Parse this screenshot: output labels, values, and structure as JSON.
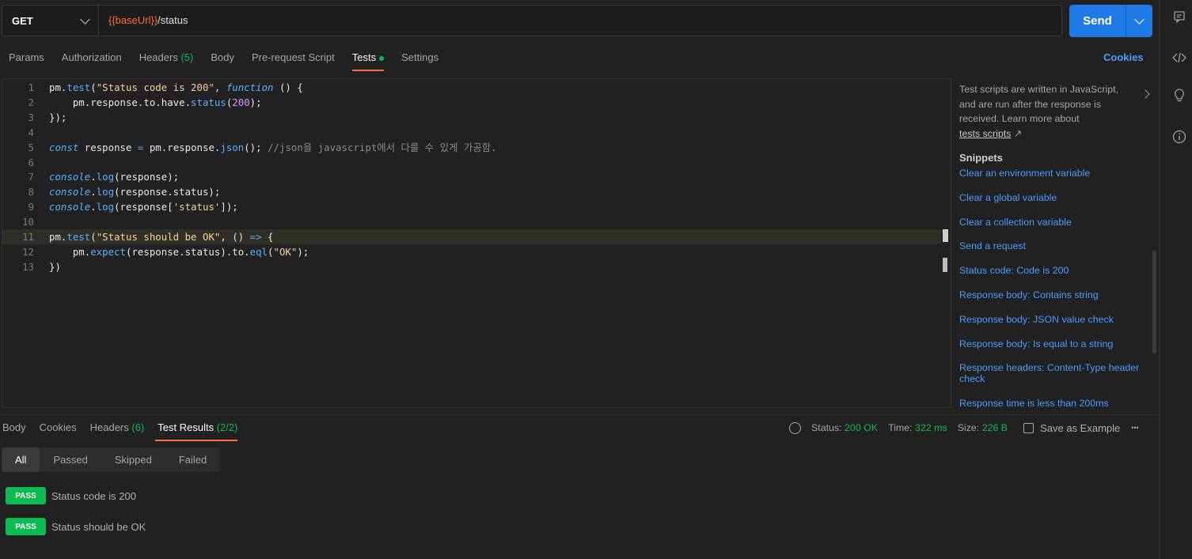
{
  "request": {
    "method": "GET",
    "url_variable": "{{baseUrl}}",
    "url_path": "/status",
    "send_label": "Send"
  },
  "request_tabs": [
    {
      "label": "Params",
      "count": "",
      "active": false
    },
    {
      "label": "Authorization",
      "count": "",
      "active": false
    },
    {
      "label": "Headers",
      "count": "(5)",
      "active": false
    },
    {
      "label": "Body",
      "count": "",
      "active": false
    },
    {
      "label": "Pre-request Script",
      "count": "",
      "active": false
    },
    {
      "label": "Tests",
      "count": "",
      "active": true,
      "dot": true
    },
    {
      "label": "Settings",
      "count": "",
      "active": false
    }
  ],
  "cookies_label": "Cookies",
  "editor": {
    "lines": [
      {
        "n": "1",
        "tokens": [
          [
            "c-def",
            "pm."
          ],
          [
            "c-fn",
            "test"
          ],
          [
            "c-def",
            "("
          ],
          [
            "c-str",
            "\"Status code is 200\""
          ],
          [
            "c-def",
            ", "
          ],
          [
            "c-kw",
            "function"
          ],
          [
            "c-def",
            " () {"
          ]
        ]
      },
      {
        "n": "2",
        "tokens": [
          [
            "c-def",
            "    pm.response.to.have."
          ],
          [
            "c-fn",
            "status"
          ],
          [
            "c-def",
            "("
          ],
          [
            "c-num",
            "200"
          ],
          [
            "c-def",
            ");"
          ]
        ]
      },
      {
        "n": "3",
        "tokens": [
          [
            "c-def",
            "});"
          ]
        ]
      },
      {
        "n": "4",
        "tokens": []
      },
      {
        "n": "5",
        "tokens": [
          [
            "c-kw",
            "const"
          ],
          [
            "c-def",
            " response "
          ],
          [
            "c-op",
            "="
          ],
          [
            "c-def",
            " pm.response."
          ],
          [
            "c-fn",
            "json"
          ],
          [
            "c-def",
            "(); "
          ],
          [
            "c-com",
            "//json을 javascript에서 다룰 수 있게 가공함."
          ]
        ]
      },
      {
        "n": "6",
        "tokens": []
      },
      {
        "n": "7",
        "tokens": [
          [
            "c-kw",
            "console"
          ],
          [
            "c-def",
            "."
          ],
          [
            "c-fn",
            "log"
          ],
          [
            "c-def",
            "(response);"
          ]
        ]
      },
      {
        "n": "8",
        "tokens": [
          [
            "c-kw",
            "console"
          ],
          [
            "c-def",
            "."
          ],
          [
            "c-fn",
            "log"
          ],
          [
            "c-def",
            "(response.status);"
          ]
        ]
      },
      {
        "n": "9",
        "tokens": [
          [
            "c-kw",
            "console"
          ],
          [
            "c-def",
            "."
          ],
          [
            "c-fn",
            "log"
          ],
          [
            "c-def",
            "(response["
          ],
          [
            "c-str",
            "'status'"
          ],
          [
            "c-def",
            "]);"
          ]
        ]
      },
      {
        "n": "10",
        "tokens": []
      },
      {
        "n": "11",
        "tokens": [
          [
            "c-def",
            "pm."
          ],
          [
            "c-fn",
            "test"
          ],
          [
            "c-def",
            "("
          ],
          [
            "c-str",
            "\"Status should be OK\""
          ],
          [
            "c-def",
            ", () "
          ],
          [
            "c-op",
            "=>"
          ],
          [
            "c-def",
            " {"
          ]
        ],
        "highlight": true
      },
      {
        "n": "12",
        "tokens": [
          [
            "c-def",
            "    pm."
          ],
          [
            "c-fn",
            "expect"
          ],
          [
            "c-def",
            "(response.status).to."
          ],
          [
            "c-fn",
            "eql"
          ],
          [
            "c-def",
            "("
          ],
          [
            "c-str",
            "\"OK\""
          ],
          [
            "c-def",
            ");"
          ]
        ]
      },
      {
        "n": "13",
        "tokens": [
          [
            "c-def",
            "})"
          ]
        ]
      }
    ]
  },
  "snippets": {
    "info_line1": "Test scripts are written in JavaScript,",
    "info_line2": "and are run after the response is",
    "info_line3": "received. Learn more about",
    "info_link": "tests scripts",
    "info_link_arrow": "↗",
    "title": "Snippets",
    "items": [
      "Clear an environment variable",
      "Clear a global variable",
      "Clear a collection variable",
      "Send a request",
      "Status code: Code is 200",
      "Response body: Contains string",
      "Response body: JSON value check",
      "Response body: Is equal to a string",
      "Response headers: Content-Type header check",
      "Response time is less than 200ms"
    ]
  },
  "response_tabs": [
    {
      "label": "Body",
      "count": "",
      "active": false
    },
    {
      "label": "Cookies",
      "count": "",
      "active": false
    },
    {
      "label": "Headers",
      "count": "(6)",
      "active": false
    },
    {
      "label": "Test Results",
      "count": "(2/2)",
      "active": true
    }
  ],
  "response_meta": {
    "status_label": "Status:",
    "status_value": "200 OK",
    "time_label": "Time:",
    "time_value": "322 ms",
    "size_label": "Size:",
    "size_value": "226 B",
    "save_label": "Save as Example",
    "more": "•••"
  },
  "filters": [
    "All",
    "Passed",
    "Skipped",
    "Failed"
  ],
  "results": [
    {
      "badge": "PASS",
      "text": "Status code is 200"
    },
    {
      "badge": "PASS",
      "text": "Status should be OK"
    }
  ],
  "colors": {
    "accent": "#ff6c37",
    "send": "#1f7ae5",
    "pass": "#0cbb52",
    "link": "#4b9cff"
  }
}
